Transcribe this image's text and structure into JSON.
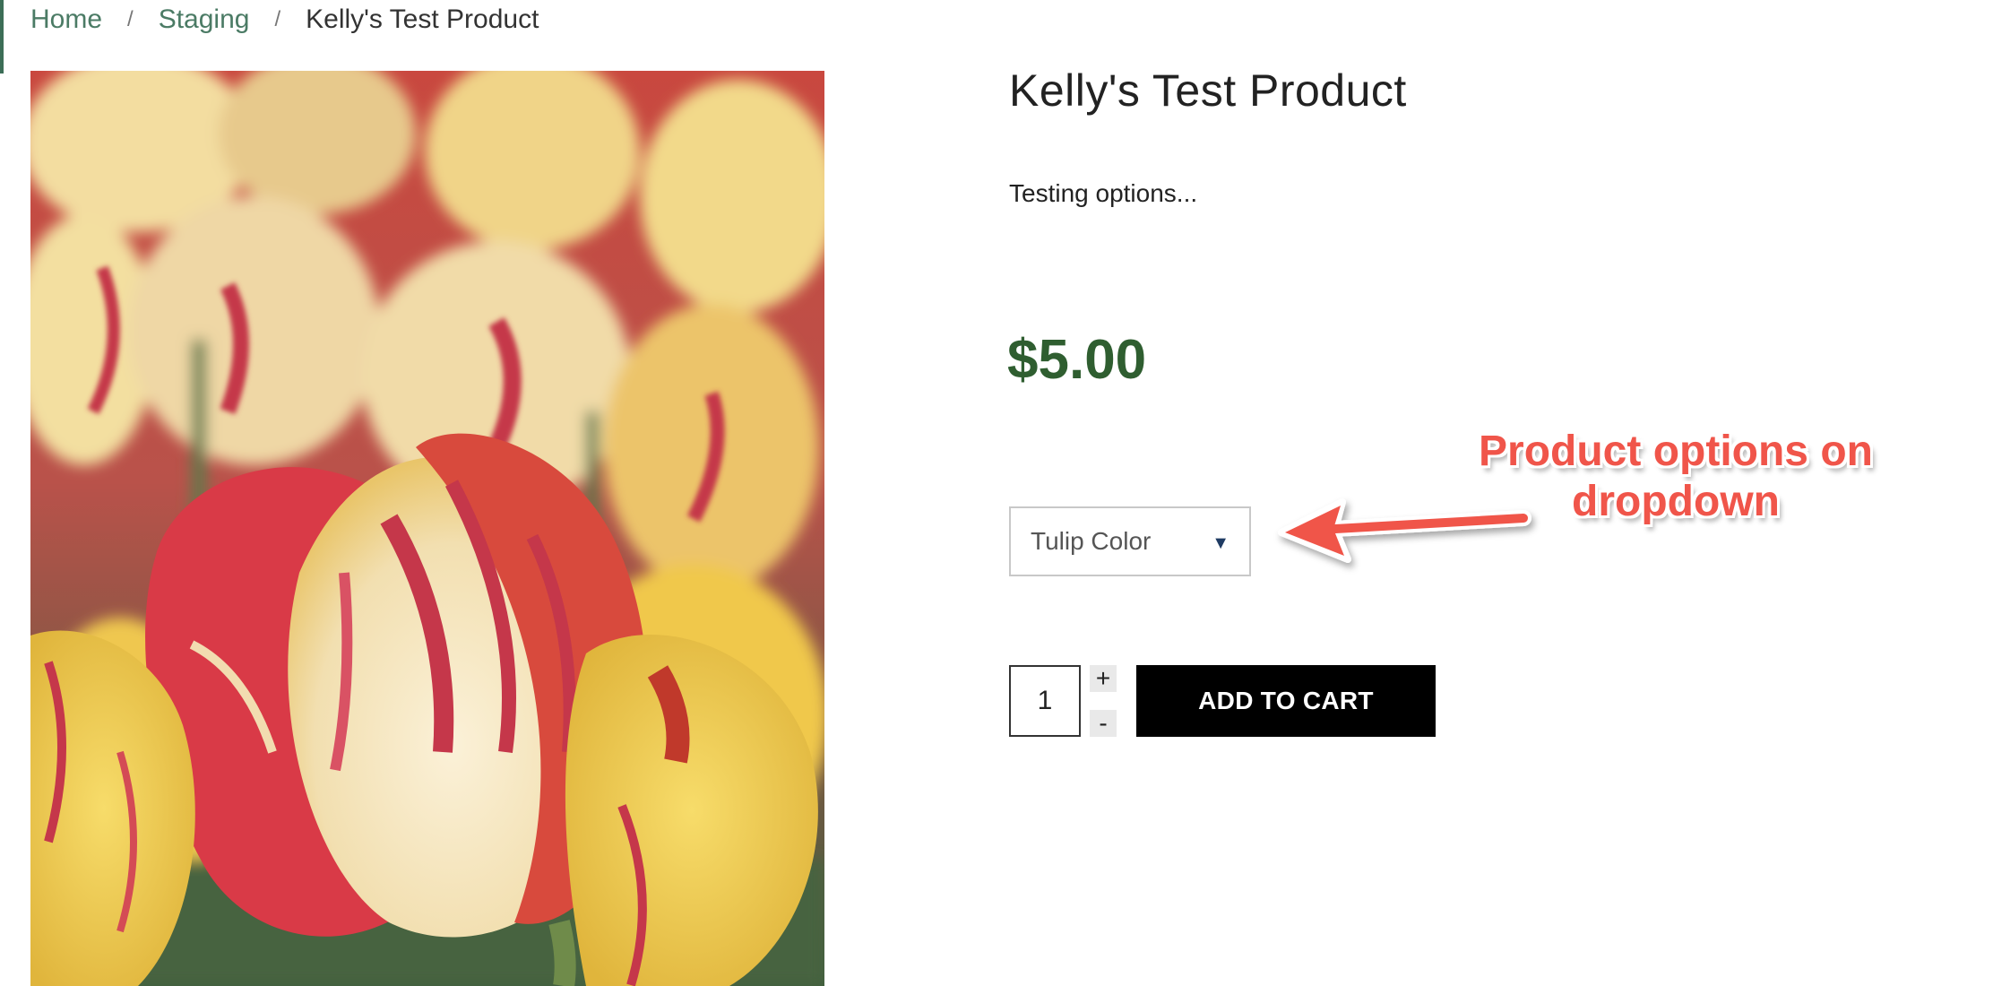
{
  "breadcrumb": {
    "home": "Home",
    "separator_1": "/",
    "staging": "Staging",
    "separator_2": "/",
    "current": "Kelly's Test Product"
  },
  "product": {
    "title": "Kelly's Test Product",
    "description": "Testing options...",
    "price": "$5.00",
    "image_subject": "tulips-photo"
  },
  "options": {
    "selected_label": "Tulip Color",
    "caret_icon": "caret-down-icon"
  },
  "quantity": {
    "value": "1",
    "plus_label": "+",
    "minus_label": "-"
  },
  "cart": {
    "add_label": "ADD TO CART"
  },
  "annotation": {
    "text": "Product options on dropdown",
    "color": "#f0554a"
  },
  "colors": {
    "accent_green": "#4b7b65",
    "price_green": "#2f5e30",
    "button_black": "#000000"
  }
}
